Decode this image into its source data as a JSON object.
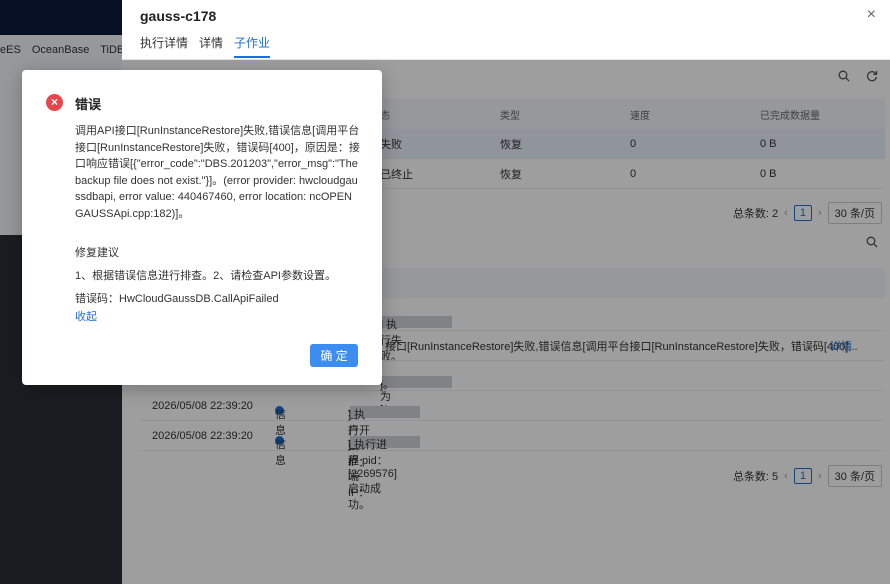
{
  "bg": {
    "tabs": [
      "eES",
      "OceanBase",
      "TiDB"
    ]
  },
  "drawer": {
    "title": "gauss-c178",
    "close": "×",
    "tabs": [
      {
        "label": "执行详情",
        "active": false
      },
      {
        "label": "详情",
        "active": false
      },
      {
        "label": "子作业",
        "active": true
      }
    ]
  },
  "subjobs": {
    "columns": [
      "态",
      "类型",
      "速度",
      "已完成数据量"
    ],
    "rows": [
      {
        "status": "失败",
        "type": "恢复",
        "speed": "0",
        "done": "0 B"
      },
      {
        "status": "已终止",
        "type": "恢复",
        "speed": "0",
        "done": "0 B"
      }
    ],
    "pager": {
      "total_label": "总条数: 2",
      "page": "1",
      "size": "30 条/页"
    }
  },
  "logs": {
    "rows": [
      {
        "time": "",
        "level": "",
        "text_pre": "IP：",
        "text_post": "] 执行失败。",
        "link": ""
      },
      {
        "time": "",
        "level": "",
        "text_pre": "接口[RunInstanceRestore]失败,错误信息[调用平台接口[RunInstanceRestore]失败，错误码[400]...",
        "text_post": "",
        "link": "详情"
      },
      {
        "time": "",
        "level": "",
        "text_pre": "P为[1",
        "text_post": "]。",
        "link": ""
      },
      {
        "time": "2026/05/08 22:39:20",
        "level": "信息",
        "text_pre": "客户端 IP：",
        "text_post": "] 执行开始。",
        "link": ""
      },
      {
        "time": "2026/05/08 22:39:20",
        "level": "信息",
        "text_pre": "客户端 IP：",
        "text_post": "] 执行进程 pid：[2269576]启动成功。",
        "link": ""
      }
    ],
    "pager": {
      "total_label": "总条数: 5",
      "page": "1",
      "size": "30 条/页"
    }
  },
  "modal": {
    "icon": "×",
    "title": "错误",
    "message": "调用API接口[RunInstanceRestore]失败,错误信息[调用平台接口[RunInstanceRestore]失败，错误码[400]，原因是：接口响应错误[{\"error_code\":\"DBS.201203\",\"error_msg\":\"The backup file does not exist.\"}]。(error provider: hwcloudgaussdbapi, error value: 440467460, error location: ncOPENGAUSSApi.cpp:182)]。",
    "suggest_title": "修复建议",
    "suggest_text": "1、根据错误信息进行排查。2、请检查API参数设置。",
    "error_code": "错误码：HwCloudGaussDB.CallApiFailed",
    "collapse": "收起",
    "ok": "确 定"
  }
}
